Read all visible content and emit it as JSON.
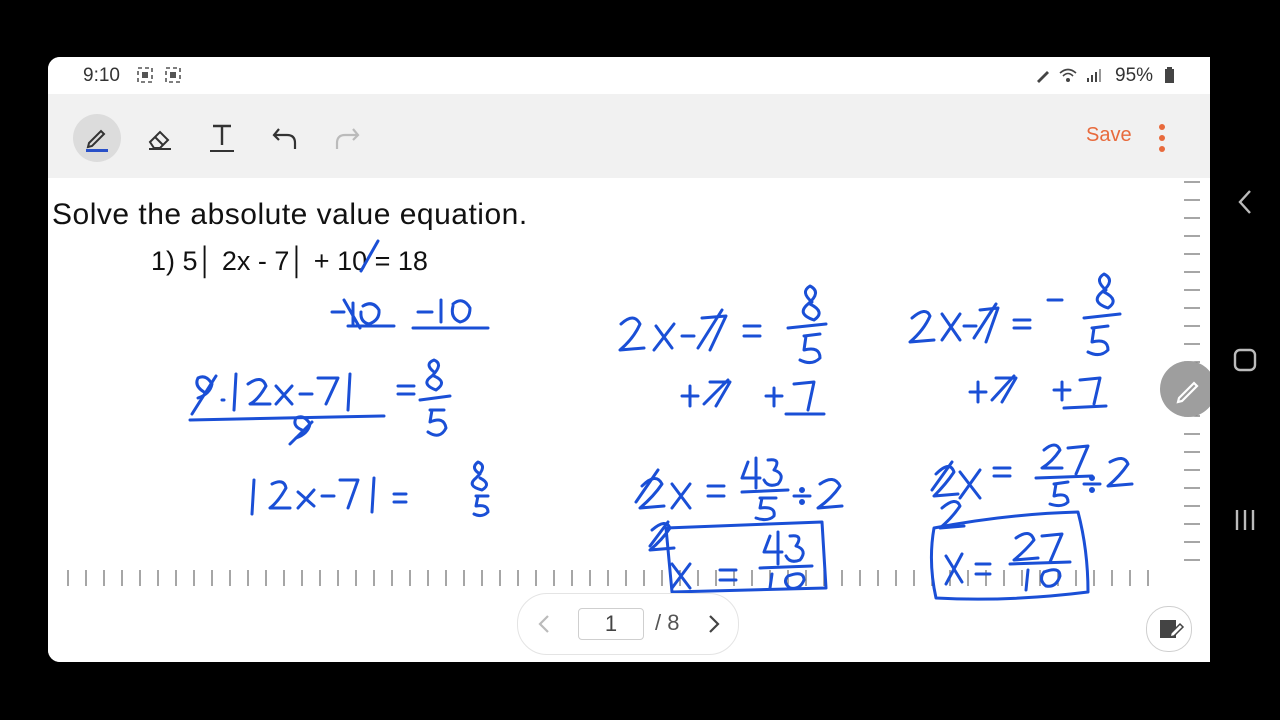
{
  "status": {
    "time": "9:10",
    "battery": "95%"
  },
  "toolbar": {
    "save_label": "Save"
  },
  "document": {
    "heading": "Solve the absolute value equation.",
    "problem": "1) 5│ 2x - 7│ + 10 = 18"
  },
  "pager": {
    "current": "1",
    "total": "/ 8"
  },
  "colors": {
    "accent": "#e86a3c",
    "ink": "#1a4fd6",
    "pen_underline": "#2950c8"
  },
  "icons": [
    "pen-icon",
    "eraser-icon",
    "text-icon",
    "undo-icon",
    "redo-icon",
    "more-icon",
    "back-icon",
    "home-icon",
    "recents-icon",
    "edit-icon"
  ]
}
